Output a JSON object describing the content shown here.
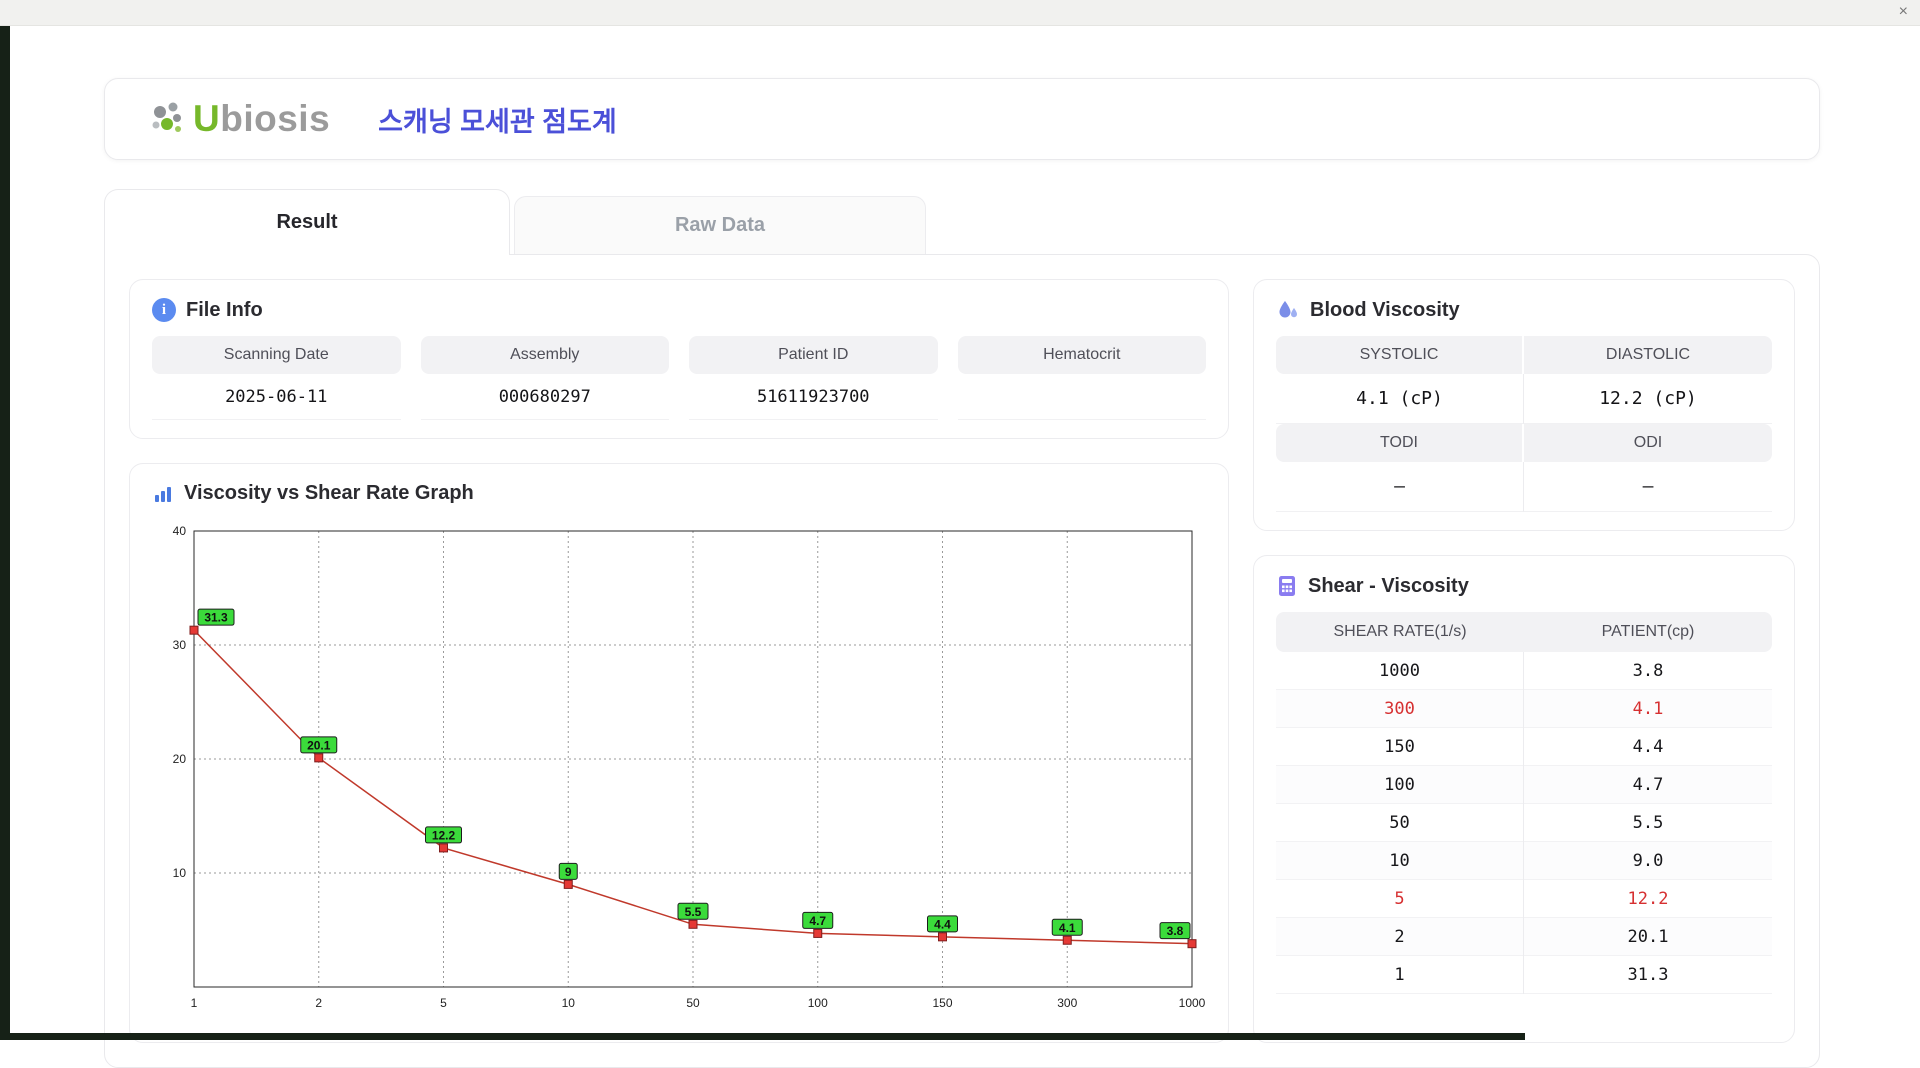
{
  "window": {
    "close": "×"
  },
  "header": {
    "brand": {
      "u": "U",
      "rest": "biosis"
    },
    "title": "스캐닝 모세관 점도계"
  },
  "tabs": {
    "result": "Result",
    "raw_data": "Raw Data"
  },
  "file_info": {
    "title": "File Info",
    "fields": [
      {
        "label": "Scanning Date",
        "value": "2025-06-11"
      },
      {
        "label": "Assembly",
        "value": "000680297"
      },
      {
        "label": "Patient ID",
        "value": "51611923700"
      },
      {
        "label": "Hematocrit",
        "value": ""
      }
    ]
  },
  "graph": {
    "title": "Viscosity vs Shear Rate Graph"
  },
  "blood_viscosity": {
    "title": "Blood Viscosity",
    "row1": {
      "h1": "SYSTOLIC",
      "h2": "DIASTOLIC",
      "v1": "4.1 (cP)",
      "v2": "12.2 (cP)"
    },
    "row2": {
      "h1": "TODI",
      "h2": "ODI",
      "v1": "–",
      "v2": "–"
    }
  },
  "shear_viscosity": {
    "title": "Shear - Viscosity",
    "columns": [
      "SHEAR RATE(1/s)",
      "PATIENT(cp)"
    ],
    "rows": [
      {
        "shear_rate": "1000",
        "patient": "3.8",
        "highlight": false
      },
      {
        "shear_rate": "300",
        "patient": "4.1",
        "highlight": true
      },
      {
        "shear_rate": "150",
        "patient": "4.4",
        "highlight": false
      },
      {
        "shear_rate": "100",
        "patient": "4.7",
        "highlight": false
      },
      {
        "shear_rate": "50",
        "patient": "5.5",
        "highlight": false
      },
      {
        "shear_rate": "10",
        "patient": "9.0",
        "highlight": false
      },
      {
        "shear_rate": "5",
        "patient": "12.2",
        "highlight": true
      },
      {
        "shear_rate": "2",
        "patient": "20.1",
        "highlight": false
      },
      {
        "shear_rate": "1",
        "patient": "31.3",
        "highlight": false
      }
    ]
  },
  "chart_data": {
    "type": "line",
    "title": "Viscosity vs Shear Rate Graph",
    "x_axis_type": "category",
    "categories": [
      "1",
      "2",
      "5",
      "10",
      "50",
      "100",
      "150",
      "300",
      "1000"
    ],
    "values": [
      31.3,
      20.1,
      12.2,
      9,
      5.5,
      4.7,
      4.4,
      4.1,
      3.8
    ],
    "point_labels": [
      "31.3",
      "20.1",
      "12.2",
      "9",
      "5.5",
      "4.7",
      "4.4",
      "4.1",
      "3.8"
    ],
    "xlabel": "",
    "ylabel": "",
    "ylim": [
      0,
      40
    ],
    "yticks": [
      10,
      20,
      30,
      40
    ],
    "grid": true,
    "legend": false,
    "line_color": "#c0392b",
    "marker_fill": "#e53935",
    "marker_border": "#7f1d1d",
    "point_label_bg": "#3bdb3b",
    "point_label_border": "#1c1c1c"
  }
}
